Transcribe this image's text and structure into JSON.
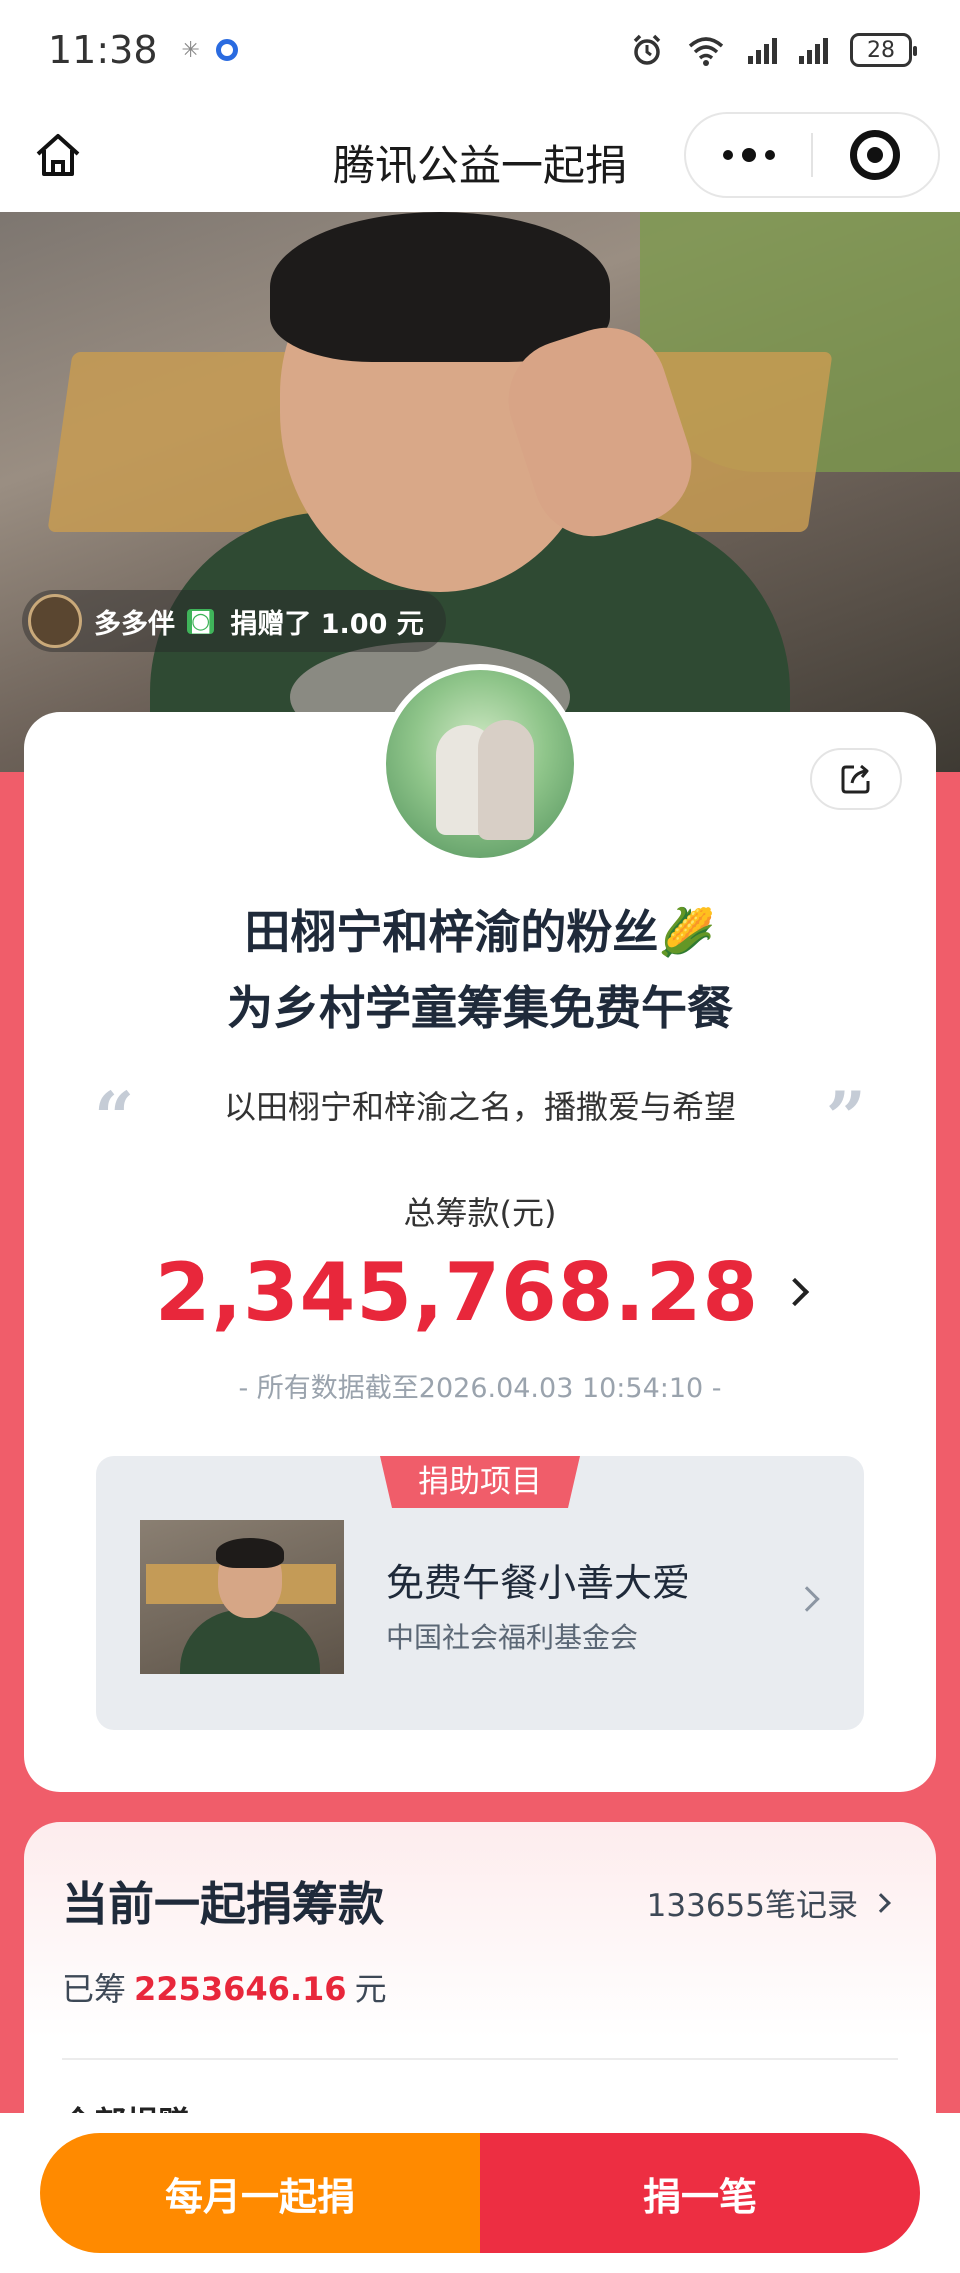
{
  "status_bar": {
    "time": "11:38",
    "battery": "28"
  },
  "nav": {
    "title": "腾讯公益一起捐"
  },
  "hero": {
    "donor_name": "多多伴",
    "donor_action": "捐赠了 1.00 元"
  },
  "campaign": {
    "title_line1": "田栩宁和梓渝的粉丝🌽",
    "title_line2": "为乡村学童筹集免费午餐",
    "slogan": "以田栩宁和梓渝之名，播撒爱与希望",
    "total_label": "总筹款(元)",
    "total_amount": "2,345,768.28",
    "data_note": "- 所有数据截至2026.04.03 10:54:10 -"
  },
  "project": {
    "tag": "捐助项目",
    "name": "免费午餐小善大爱",
    "org": "中国社会福利基金会"
  },
  "raise": {
    "title": "当前一起捐筹款",
    "records": "133655笔记录",
    "raised_prefix": "已筹",
    "raised_amount": "2253646.16",
    "raised_suffix": "元",
    "all_donations": "全部捐赠"
  },
  "actions": {
    "monthly": "每月一起捐",
    "once": "捐一笔"
  },
  "colors": {
    "accent_red": "#e8273b",
    "page_bg": "#f05d6a",
    "monthly_orange": "#ff8a00"
  }
}
